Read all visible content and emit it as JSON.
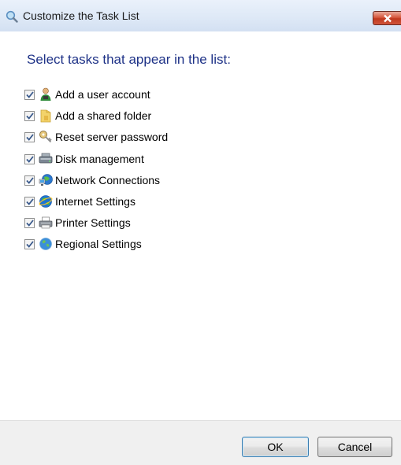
{
  "window": {
    "title": "Customize the Task List",
    "title_icon": "search-icon",
    "close_icon": "close-icon"
  },
  "heading": "Select tasks that appear in the list:",
  "tasks": [
    {
      "label": "Add a user account",
      "icon": "user-icon",
      "checked": true
    },
    {
      "label": "Add a shared folder",
      "icon": "folder-icon",
      "checked": true
    },
    {
      "label": "Reset server password",
      "icon": "key-icon",
      "checked": true
    },
    {
      "label": "Disk management",
      "icon": "disk-icon",
      "checked": true
    },
    {
      "label": "Network Connections",
      "icon": "network-icon",
      "checked": true
    },
    {
      "label": "Internet Settings",
      "icon": "globe-icon",
      "checked": true
    },
    {
      "label": "Printer Settings",
      "icon": "printer-icon",
      "checked": true
    },
    {
      "label": "Regional Settings",
      "icon": "regional-globe-icon",
      "checked": true
    }
  ],
  "buttons": {
    "ok_label": "OK",
    "cancel_label": "Cancel"
  },
  "colors": {
    "heading": "#1e3287",
    "close_button": "#c0391f"
  }
}
